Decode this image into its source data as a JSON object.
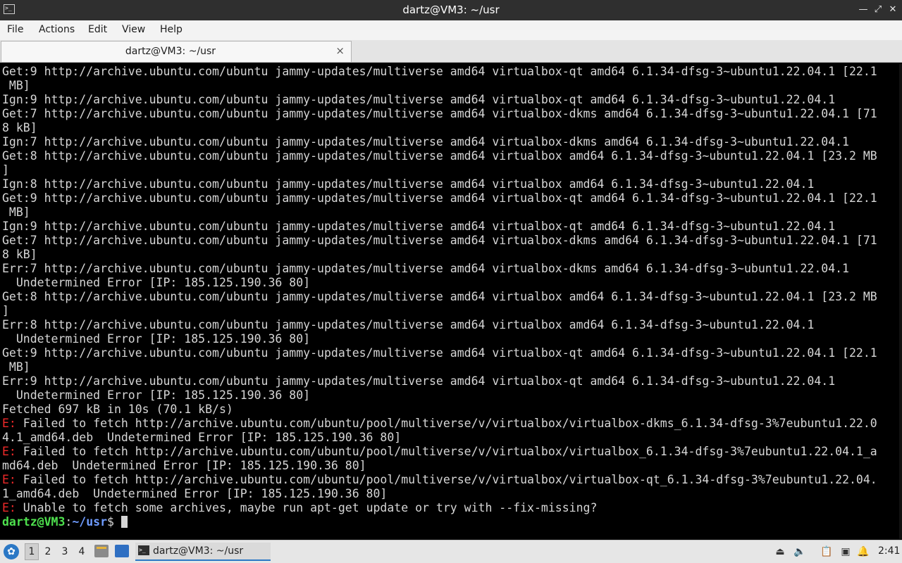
{
  "window": {
    "title": "dartz@VM3: ~/usr",
    "controls": {
      "minimize_icon": "minimize-icon",
      "maximize_icon": "maximize-icon",
      "close_icon": "close-icon"
    }
  },
  "menu": [
    "File",
    "Actions",
    "Edit",
    "View",
    "Help"
  ],
  "tab": {
    "label": "dartz@VM3: ~/usr",
    "close_glyph": "×"
  },
  "terminal": {
    "lines": [
      {
        "text": "Get:9 http://archive.ubuntu.com/ubuntu jammy-updates/multiverse amd64 virtualbox-qt amd64 6.1.34-dfsg-3~ubuntu1.22.04.1 [22.1"
      },
      {
        "text": " MB]"
      },
      {
        "text": "Ign:9 http://archive.ubuntu.com/ubuntu jammy-updates/multiverse amd64 virtualbox-qt amd64 6.1.34-dfsg-3~ubuntu1.22.04.1"
      },
      {
        "text": "Get:7 http://archive.ubuntu.com/ubuntu jammy-updates/multiverse amd64 virtualbox-dkms amd64 6.1.34-dfsg-3~ubuntu1.22.04.1 [71"
      },
      {
        "text": "8 kB]"
      },
      {
        "text": "Ign:7 http://archive.ubuntu.com/ubuntu jammy-updates/multiverse amd64 virtualbox-dkms amd64 6.1.34-dfsg-3~ubuntu1.22.04.1"
      },
      {
        "text": "Get:8 http://archive.ubuntu.com/ubuntu jammy-updates/multiverse amd64 virtualbox amd64 6.1.34-dfsg-3~ubuntu1.22.04.1 [23.2 MB"
      },
      {
        "text": "]"
      },
      {
        "text": "Ign:8 http://archive.ubuntu.com/ubuntu jammy-updates/multiverse amd64 virtualbox amd64 6.1.34-dfsg-3~ubuntu1.22.04.1"
      },
      {
        "text": "Get:9 http://archive.ubuntu.com/ubuntu jammy-updates/multiverse amd64 virtualbox-qt amd64 6.1.34-dfsg-3~ubuntu1.22.04.1 [22.1"
      },
      {
        "text": " MB]"
      },
      {
        "text": "Ign:9 http://archive.ubuntu.com/ubuntu jammy-updates/multiverse amd64 virtualbox-qt amd64 6.1.34-dfsg-3~ubuntu1.22.04.1"
      },
      {
        "text": "Get:7 http://archive.ubuntu.com/ubuntu jammy-updates/multiverse amd64 virtualbox-dkms amd64 6.1.34-dfsg-3~ubuntu1.22.04.1 [71"
      },
      {
        "text": "8 kB]"
      },
      {
        "text": "Err:7 http://archive.ubuntu.com/ubuntu jammy-updates/multiverse amd64 virtualbox-dkms amd64 6.1.34-dfsg-3~ubuntu1.22.04.1"
      },
      {
        "text": "  Undetermined Error [IP: 185.125.190.36 80]"
      },
      {
        "text": "Get:8 http://archive.ubuntu.com/ubuntu jammy-updates/multiverse amd64 virtualbox amd64 6.1.34-dfsg-3~ubuntu1.22.04.1 [23.2 MB"
      },
      {
        "text": "]"
      },
      {
        "text": "Err:8 http://archive.ubuntu.com/ubuntu jammy-updates/multiverse amd64 virtualbox amd64 6.1.34-dfsg-3~ubuntu1.22.04.1"
      },
      {
        "text": "  Undetermined Error [IP: 185.125.190.36 80]"
      },
      {
        "text": "Get:9 http://archive.ubuntu.com/ubuntu jammy-updates/multiverse amd64 virtualbox-qt amd64 6.1.34-dfsg-3~ubuntu1.22.04.1 [22.1"
      },
      {
        "text": " MB]"
      },
      {
        "text": "Err:9 http://archive.ubuntu.com/ubuntu jammy-updates/multiverse amd64 virtualbox-qt amd64 6.1.34-dfsg-3~ubuntu1.22.04.1"
      },
      {
        "text": "  Undetermined Error [IP: 185.125.190.36 80]"
      },
      {
        "text": "Fetched 697 kB in 10s (70.1 kB/s)"
      },
      {
        "prefix": "E:",
        "text": " Failed to fetch http://archive.ubuntu.com/ubuntu/pool/multiverse/v/virtualbox/virtualbox-dkms_6.1.34-dfsg-3%7eubuntu1.22.0"
      },
      {
        "text": "4.1_amd64.deb  Undetermined Error [IP: 185.125.190.36 80]"
      },
      {
        "prefix": "E:",
        "text": " Failed to fetch http://archive.ubuntu.com/ubuntu/pool/multiverse/v/virtualbox/virtualbox_6.1.34-dfsg-3%7eubuntu1.22.04.1_a"
      },
      {
        "text": "md64.deb  Undetermined Error [IP: 185.125.190.36 80]"
      },
      {
        "prefix": "E:",
        "text": " Failed to fetch http://archive.ubuntu.com/ubuntu/pool/multiverse/v/virtualbox/virtualbox-qt_6.1.34-dfsg-3%7eubuntu1.22.04."
      },
      {
        "text": "1_amd64.deb  Undetermined Error [IP: 185.125.190.36 80]"
      },
      {
        "prefix": "E:",
        "text": " Unable to fetch some archives, maybe run apt-get update or try with --fix-missing?"
      }
    ],
    "prompt": {
      "user_host": "dartz@VM3",
      "sep": ":",
      "path": "~/usr",
      "symbol": "$ "
    }
  },
  "taskbar": {
    "start_icon": "lxqt-menu-icon",
    "workspaces": [
      "1",
      "2",
      "3",
      "4"
    ],
    "active_workspace": "1",
    "task": {
      "label": "dartz@VM3: ~/usr"
    },
    "tray_icons": [
      "removable-media-icon",
      "volume-icon",
      "clipboard-icon",
      "network-icon",
      "notification-icon"
    ],
    "clock": "2:41"
  },
  "colors": {
    "error": "#ef2929",
    "prompt_user": "#4ee14e",
    "prompt_path": "#6f9cff",
    "accent": "#2b78c5"
  }
}
